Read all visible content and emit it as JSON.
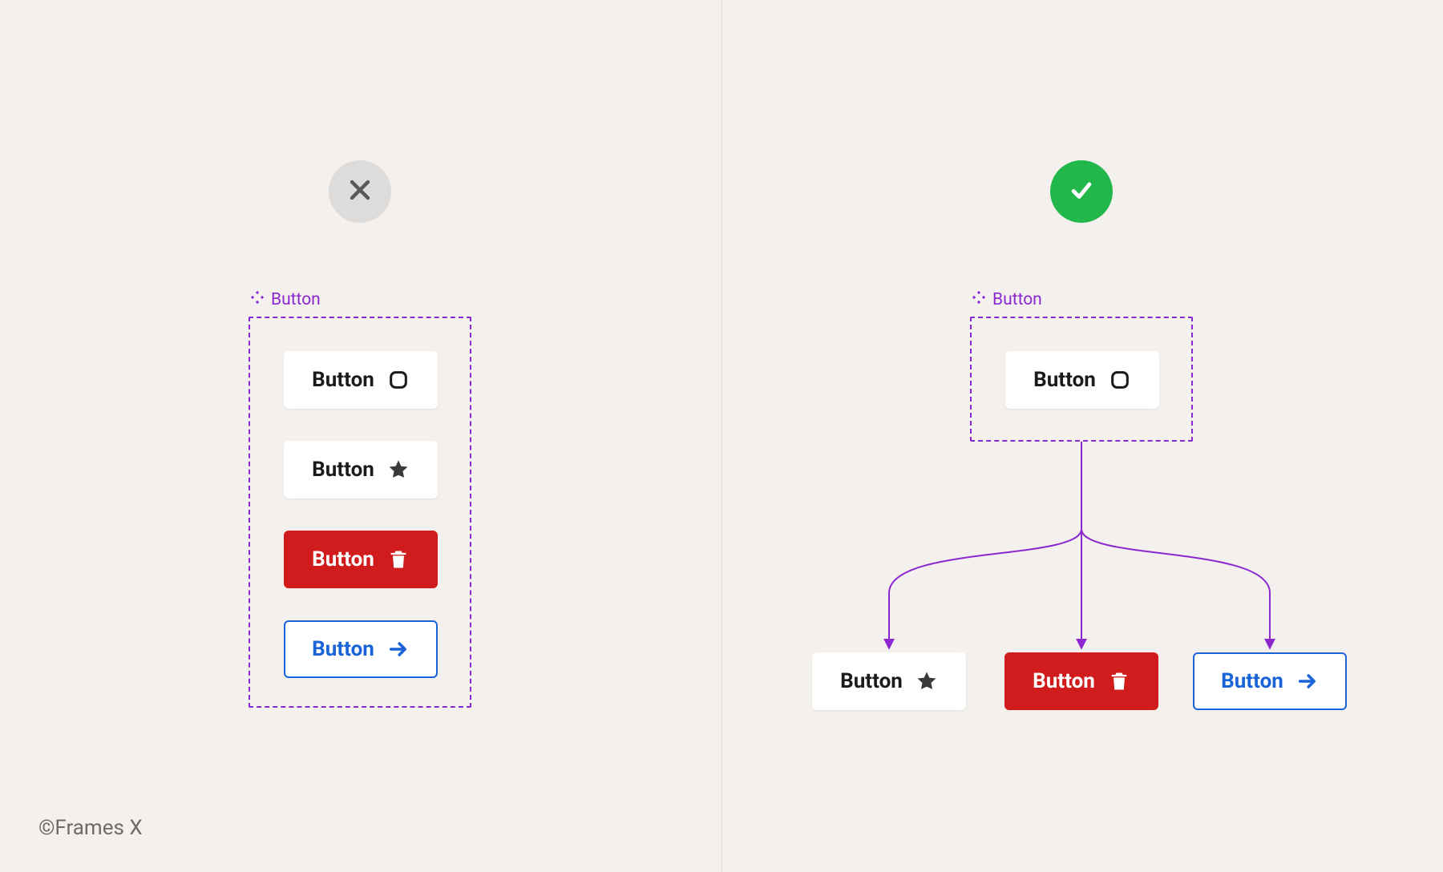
{
  "footer": "©Frames X",
  "colors": {
    "bg": "#f4f0ed",
    "purple": "#8b28cf",
    "red": "#d01c1c",
    "blue": "#1a63d8",
    "green": "#22b74a",
    "gray_badge": "#dedcdb",
    "text_dark": "#1b1b1b"
  },
  "left": {
    "status": "wrong",
    "frame_label": "Button",
    "buttons": [
      {
        "label": "Button",
        "style": "white",
        "icon": "rounded-square"
      },
      {
        "label": "Button",
        "style": "white",
        "icon": "star"
      },
      {
        "label": "Button",
        "style": "red",
        "icon": "trash"
      },
      {
        "label": "Button",
        "style": "outline",
        "icon": "arrow-right"
      }
    ]
  },
  "right": {
    "status": "correct",
    "frame_label": "Button",
    "master": {
      "label": "Button",
      "style": "white",
      "icon": "rounded-square"
    },
    "children": [
      {
        "label": "Button",
        "style": "white",
        "icon": "star"
      },
      {
        "label": "Button",
        "style": "red",
        "icon": "trash"
      },
      {
        "label": "Button",
        "style": "outline",
        "icon": "arrow-right"
      }
    ]
  }
}
